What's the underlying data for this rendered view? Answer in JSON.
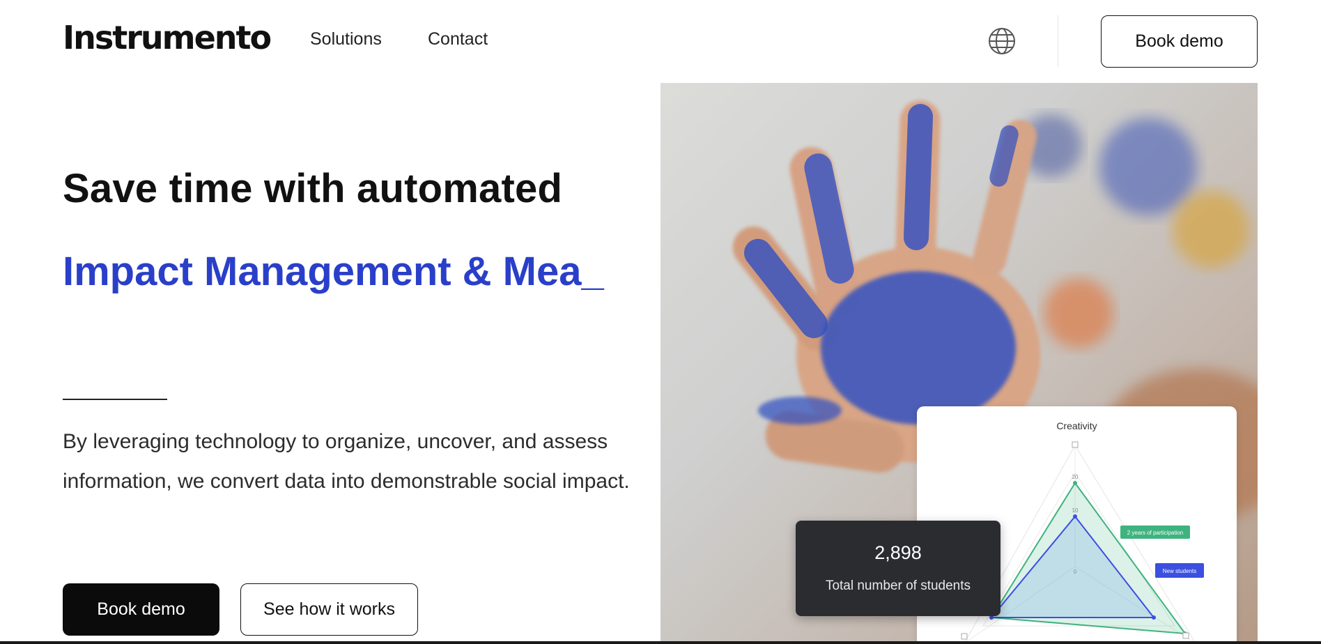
{
  "header": {
    "logo": "Instrumento",
    "nav": [
      "Solutions",
      "Contact"
    ],
    "cta_label": "Book demo",
    "icons": [
      "globe-icon"
    ]
  },
  "hero": {
    "title": "Save time with automated",
    "typed_text": "Impact Management & Mea_",
    "description": "By leveraging technology to organize, uncover, and assess information, we convert data into demonstrable social impact.",
    "primary_button": "Book demo",
    "secondary_button": "See how it works"
  },
  "chart_card": {
    "title": "Creativity",
    "tick_labels": [
      "20",
      "10",
      "0"
    ],
    "tags": [
      "2 years of participation",
      "New students"
    ],
    "colors": {
      "green": "#3fb37f",
      "blue": "#3b4fe0"
    }
  },
  "stat_card": {
    "value": "2,898",
    "label": "Total number of students"
  },
  "colors": {
    "accent": "#2a3fc9",
    "dark": "#0b0b0b"
  }
}
